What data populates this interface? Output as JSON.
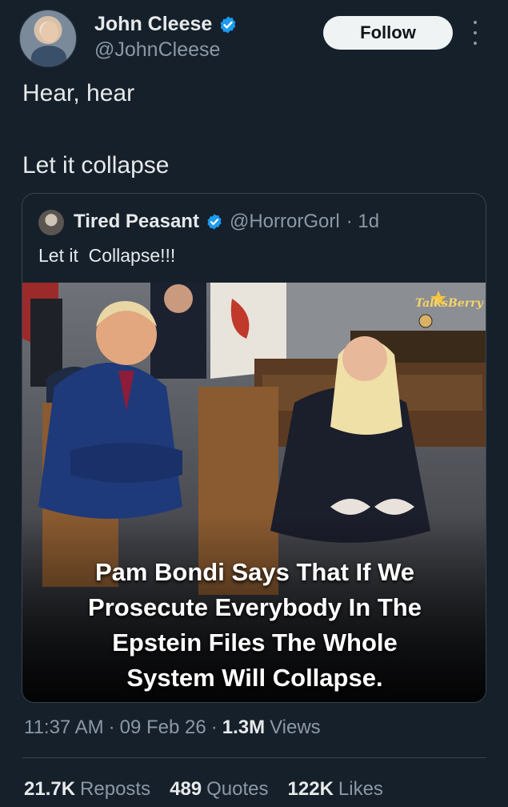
{
  "author": {
    "name": "John Cleese",
    "handle": "@JohnCleese",
    "follow_label": "Follow"
  },
  "tweet": {
    "line1": "Hear, hear",
    "line2": "Let it collapse"
  },
  "quoted": {
    "name": "Tired Peasant",
    "handle": "@HorrorGorl",
    "time": "· 1d",
    "text": "Let it  Collapse!!!",
    "image": {
      "brand": "TalksBerry",
      "caption_line1": "Pam Bondi Says That If We",
      "caption_line2": "Prosecute Everybody In The",
      "caption_line3": "Epstein Files The Whole",
      "caption_line4": "System Will Collapse."
    }
  },
  "meta": {
    "time": "11:37 AM",
    "sep1": "·",
    "date": "09 Feb 26",
    "sep2": "·",
    "views_count": "1.3M",
    "views_label": "Views"
  },
  "stats": {
    "reposts_count": "21.7K",
    "reposts_label": "Reposts",
    "quotes_count": "489",
    "quotes_label": "Quotes",
    "likes_count": "122K",
    "likes_label": "Likes"
  },
  "colors": {
    "background": "#15202b",
    "text_primary": "#e7e9ea",
    "text_secondary": "#8b98a5",
    "verified": "#1d9bf0",
    "border": "#38444d"
  }
}
